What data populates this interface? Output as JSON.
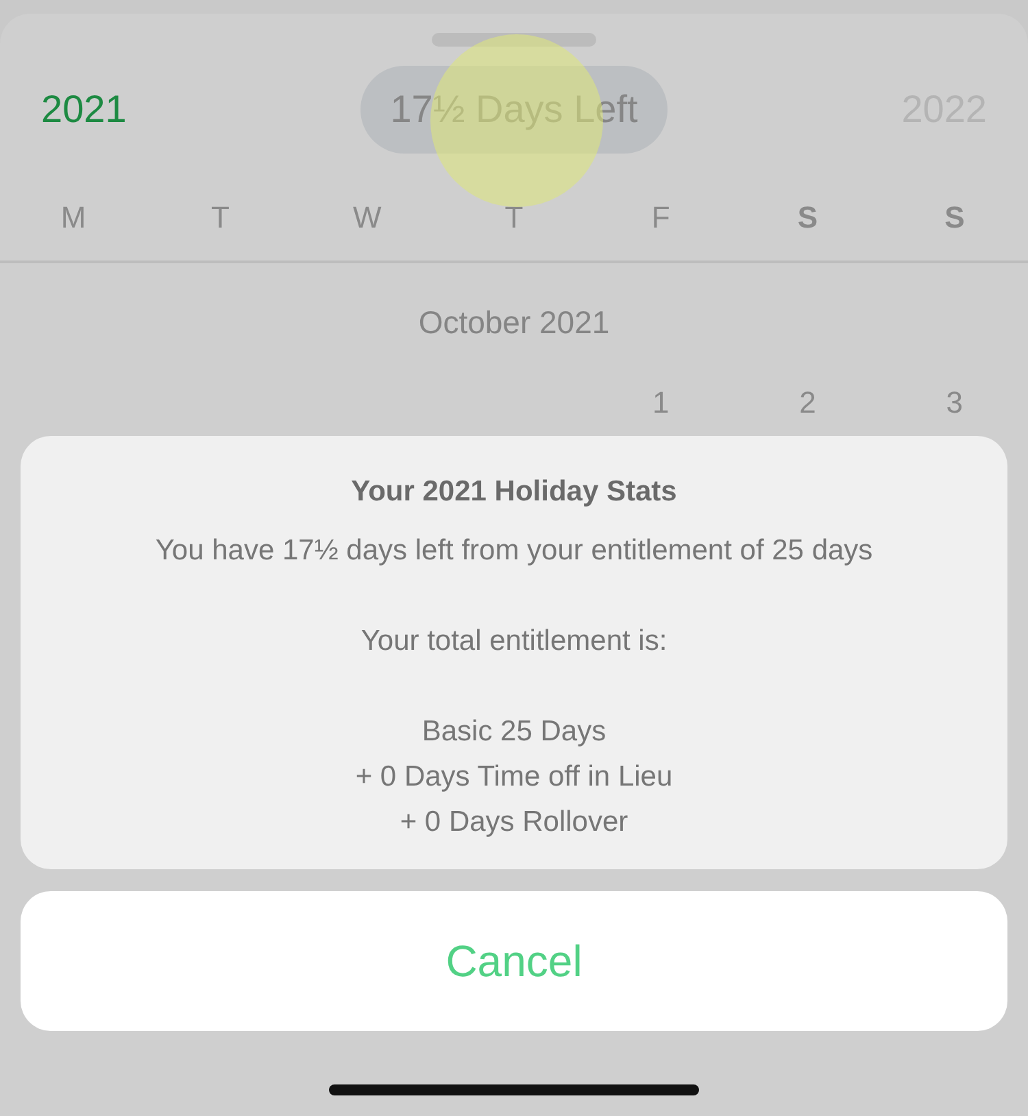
{
  "sheet": {
    "years": [
      {
        "label": "2021",
        "selected": true
      },
      {
        "label": "2022",
        "selected": false
      }
    ],
    "days_left": "17½ Days Left",
    "weekdays": [
      {
        "label": "M",
        "weekend": false
      },
      {
        "label": "T",
        "weekend": false
      },
      {
        "label": "W",
        "weekend": false
      },
      {
        "label": "T",
        "weekend": false
      },
      {
        "label": "F",
        "weekend": false
      },
      {
        "label": "S",
        "weekend": true
      },
      {
        "label": "S",
        "weekend": true
      }
    ],
    "month": "October 2021",
    "first_week": [
      "1",
      "2",
      "3"
    ]
  },
  "alert": {
    "title": "Your 2021 Holiday Stats",
    "paragraphs": [
      [
        "You have 17½ days left from your entitlement of 25 days"
      ],
      [
        "Your total entitlement is:"
      ],
      [
        "Basic 25 Days",
        "+ 0 Days Time off in Lieu",
        "+ 0 Days Rollover"
      ]
    ]
  },
  "cancel": "Cancel"
}
